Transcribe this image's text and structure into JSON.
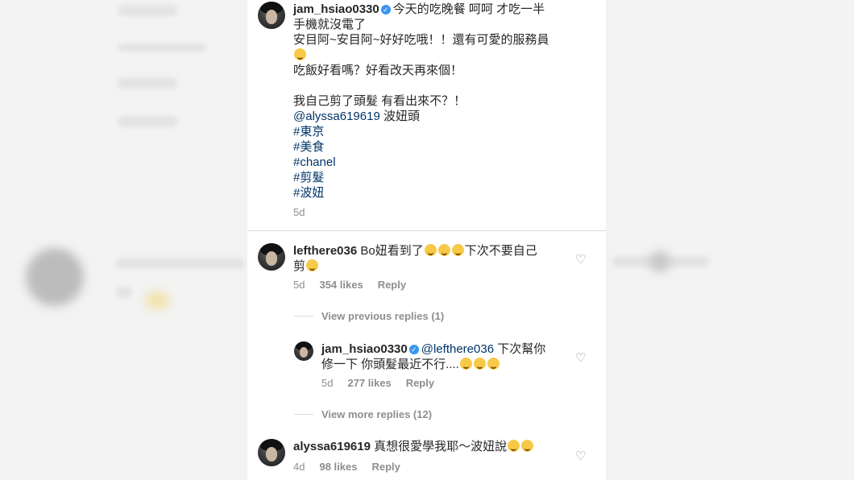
{
  "caption": {
    "username": "jam_hsiao0330",
    "lines": [
      "今天的吃晚餐 呵呵 才吃一半",
      "手機就沒電了",
      "安目阿~安目阿~好好吃哦！！還有可愛的服務員",
      "吃飯好看嗎？好看改天再來個！",
      "我自己剪了頭髮 有看出來不？！"
    ],
    "mention": "@alyssa619619",
    "mention_suffix": " 波妞頭",
    "hashtags": [
      "#東京",
      "#美食",
      "#chanel",
      "#剪髮",
      "#波妞"
    ],
    "time": "5d"
  },
  "comments": [
    {
      "username": "lefthere036",
      "text_line1": "Bo妞看到了",
      "text_line1_after": "下次不要自己",
      "text_line2": "剪",
      "time": "5d",
      "likes": "354 likes",
      "reply": "Reply",
      "view_replies": "View previous replies (1)"
    },
    {
      "username": "jam_hsiao0330",
      "mention": "@lefthere036",
      "text_line1_after": " 下次幫你",
      "text_line2": "修一下 你頭髮最近不行....",
      "time": "5d",
      "likes": "277 likes",
      "reply": "Reply",
      "view_replies": "View more replies (12)"
    },
    {
      "username": "alyssa619619",
      "text": "真想很愛學我耶～波妞說",
      "time": "4d",
      "likes": "98 likes",
      "reply": "Reply"
    }
  ],
  "icons": {
    "heart": "♡",
    "verified": "✓"
  }
}
